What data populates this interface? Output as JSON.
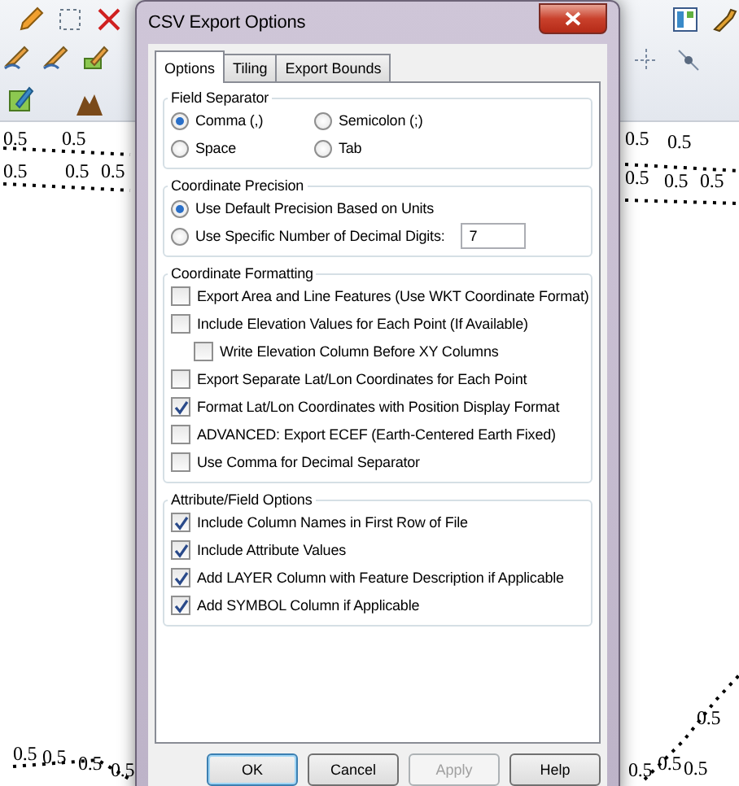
{
  "map_labels": [
    "0.5",
    "0.5",
    "0.5",
    "0.5",
    "0.5",
    "0.5",
    "0.5",
    "0.5",
    "0.5",
    "0.5",
    "0.5",
    "0.5",
    "0.5",
    "0.5",
    "0.5",
    "0.5",
    "0.5",
    "0.5"
  ],
  "dialog": {
    "title": "CSV Export Options",
    "tabs": [
      {
        "label": "Options",
        "selected": true
      },
      {
        "label": "Tiling",
        "selected": false
      },
      {
        "label": "Export Bounds",
        "selected": false
      }
    ],
    "field_separator": {
      "title": "Field Separator",
      "options": [
        {
          "label": "Comma (,)",
          "selected": true
        },
        {
          "label": "Semicolon (;)",
          "selected": false
        },
        {
          "label": "Space",
          "selected": false
        },
        {
          "label": "Tab",
          "selected": false
        }
      ]
    },
    "coordinate_precision": {
      "title": "Coordinate Precision",
      "options": [
        {
          "label": "Use Default Precision Based on Units",
          "selected": true
        },
        {
          "label": "Use Specific Number of Decimal Digits:",
          "selected": false
        }
      ],
      "digits_value": "7"
    },
    "coordinate_formatting": {
      "title": "Coordinate Formatting",
      "items": [
        {
          "label": "Export Area and Line Features (Use WKT Coordinate Format)",
          "checked": false
        },
        {
          "label": "Include Elevation Values for Each Point (If Available)",
          "checked": false,
          "children": [
            {
              "label": "Write Elevation Column Before XY Columns",
              "checked": false
            }
          ]
        },
        {
          "label": "Export Separate Lat/Lon Coordinates for Each Point",
          "checked": false
        },
        {
          "label": "Format Lat/Lon Coordinates with Position Display Format",
          "checked": true
        },
        {
          "label": "ADVANCED: Export ECEF (Earth-Centered Earth Fixed)",
          "checked": false
        },
        {
          "label": "Use Comma for Decimal Separator",
          "checked": false
        }
      ]
    },
    "attribute_options": {
      "title": "Attribute/Field Options",
      "items": [
        {
          "label": "Include Column Names in First Row of File",
          "checked": true
        },
        {
          "label": "Include Attribute Values",
          "checked": true
        },
        {
          "label": "Add LAYER Column with Feature Description if Applicable",
          "checked": true
        },
        {
          "label": "Add SYMBOL Column if Applicable",
          "checked": true
        }
      ]
    },
    "buttons": [
      {
        "label": "OK",
        "kind": "default"
      },
      {
        "label": "Cancel",
        "kind": "normal"
      },
      {
        "label": "Apply",
        "kind": "disabled"
      },
      {
        "label": "Help",
        "kind": "normal"
      }
    ]
  }
}
